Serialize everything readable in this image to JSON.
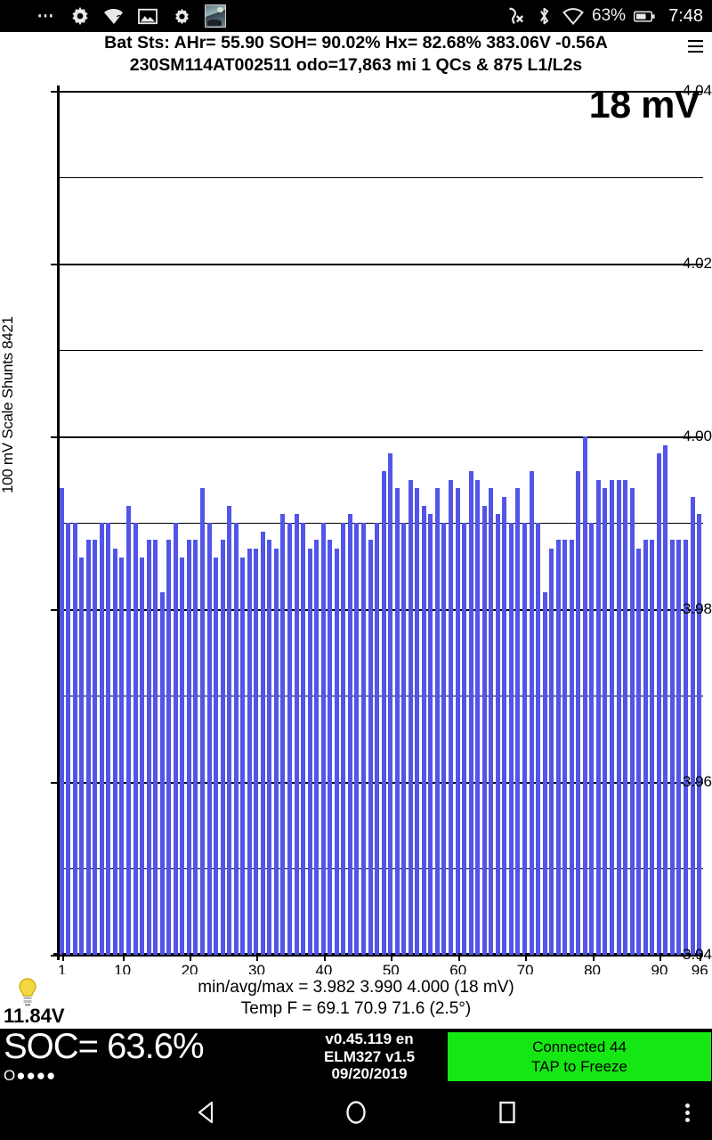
{
  "statusbar": {
    "icons": [
      "more-dots-icon",
      "settings-gear-icon",
      "wifi-question-icon",
      "image-icon",
      "gear-icon",
      "photo-thumbnail-icon"
    ],
    "mute_icon": "ringer-off-icon",
    "bluetooth_icon": "bluetooth-icon",
    "wifi_icon": "wifi-icon",
    "battery_percent": "63%",
    "battery_icon": "battery-icon",
    "time": "7:48"
  },
  "header": {
    "line1": "Bat Sts:  AHr= 55.90  SOH= 90.02%   Hx= 82.68%   383.06V -0.56A",
    "line2": "230SM114AT002511 odo=17,863 mi  1 QCs & 875 L1/L2s",
    "menu_icon": "hamburger-menu-icon"
  },
  "chart_data": {
    "type": "bar",
    "title": "",
    "annotation": "18 mV",
    "ylabel": "100 mV Scale  Shunts 8421",
    "xlabel": "",
    "ylim": [
      3.94,
      4.04
    ],
    "ytick_labels": [
      "4.04",
      "4.02",
      "4.00",
      "3.98",
      "3.96",
      "3.94"
    ],
    "ytick_values": [
      4.04,
      4.02,
      4.0,
      3.98,
      3.96,
      3.94
    ],
    "minor_gridlines": [
      4.03,
      4.01,
      3.99,
      3.97,
      3.95
    ],
    "grid": true,
    "xtick_labels": [
      "1",
      "10",
      "20",
      "30",
      "40",
      "50",
      "60",
      "70",
      "80",
      "90",
      "96"
    ],
    "xtick_values": [
      1,
      10,
      20,
      30,
      40,
      50,
      60,
      70,
      80,
      90,
      96
    ],
    "bar_color": "#5255e8",
    "categories": [
      1,
      2,
      3,
      4,
      5,
      6,
      7,
      8,
      9,
      10,
      11,
      12,
      13,
      14,
      15,
      16,
      17,
      18,
      19,
      20,
      21,
      22,
      23,
      24,
      25,
      26,
      27,
      28,
      29,
      30,
      31,
      32,
      33,
      34,
      35,
      36,
      37,
      38,
      39,
      40,
      41,
      42,
      43,
      44,
      45,
      46,
      47,
      48,
      49,
      50,
      51,
      52,
      53,
      54,
      55,
      56,
      57,
      58,
      59,
      60,
      61,
      62,
      63,
      64,
      65,
      66,
      67,
      68,
      69,
      70,
      71,
      72,
      73,
      74,
      75,
      76,
      77,
      78,
      79,
      80,
      81,
      82,
      83,
      84,
      85,
      86,
      87,
      88,
      89,
      90,
      91,
      92,
      93,
      94,
      95,
      96
    ],
    "values": [
      3.994,
      3.99,
      3.99,
      3.986,
      3.988,
      3.988,
      3.99,
      3.99,
      3.987,
      3.986,
      3.992,
      3.99,
      3.986,
      3.988,
      3.988,
      3.982,
      3.988,
      3.99,
      3.986,
      3.988,
      3.988,
      3.994,
      3.99,
      3.986,
      3.988,
      3.992,
      3.99,
      3.986,
      3.987,
      3.987,
      3.989,
      3.988,
      3.987,
      3.991,
      3.99,
      3.991,
      3.99,
      3.987,
      3.988,
      3.99,
      3.988,
      3.987,
      3.99,
      3.991,
      3.99,
      3.99,
      3.988,
      3.99,
      3.996,
      3.998,
      3.994,
      3.99,
      3.995,
      3.994,
      3.992,
      3.991,
      3.994,
      3.99,
      3.995,
      3.994,
      3.99,
      3.996,
      3.995,
      3.992,
      3.994,
      3.991,
      3.993,
      3.99,
      3.994,
      3.99,
      3.996,
      3.99,
      3.982,
      3.987,
      3.988,
      3.988,
      3.988,
      3.996,
      4.0,
      3.99,
      3.995,
      3.994,
      3.995,
      3.995,
      3.995,
      3.994,
      3.987,
      3.988,
      3.988,
      3.998,
      3.999,
      3.988,
      3.988,
      3.988,
      3.993,
      3.991
    ],
    "min": 3.982,
    "avg": 3.99,
    "max": 4.0
  },
  "footer": {
    "bulb_icon": "light-bulb-icon",
    "voltage": "11.84V",
    "minmax": "min/avg/max = 3.982 3.990 4.000  (18 mV)",
    "tempf": "Temp F = 69.1  70.9  71.6  (2.5°)"
  },
  "statusblock": {
    "soc": "SOC= 63.6%",
    "soc_dots": "O●●●●",
    "version_line1": "v0.45.119 en",
    "version_line2": "ELM327 v1.5",
    "version_line3": "09/20/2019",
    "connected_line1": "Connected 44",
    "connected_line2": "TAP to Freeze",
    "connected_color": "#15e715"
  },
  "navbar": {
    "back_icon": "back-triangle-icon",
    "home_icon": "home-circle-icon",
    "recent_icon": "recents-square-icon",
    "more_icon": "overflow-dots-icon"
  }
}
